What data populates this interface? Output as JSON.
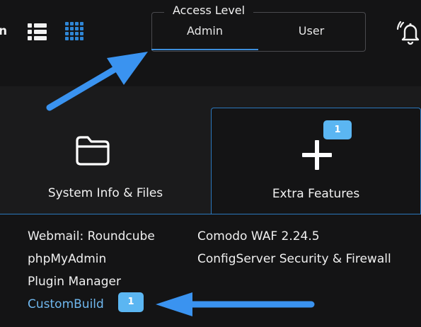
{
  "topbar": {
    "partial_label": "n",
    "list_view_icon": "list-view-icon",
    "grid_view_icon": "grid-view-icon",
    "notifications_icon": "bell-icon"
  },
  "access_level": {
    "legend": "Access Level",
    "tabs": [
      "Admin",
      "User"
    ],
    "selected": "Admin"
  },
  "cards": {
    "system_info": {
      "label": "System Info & Files",
      "icon": "folder-icon"
    },
    "extra_features": {
      "label": "Extra Features",
      "icon": "plus-icon",
      "badge": "1"
    }
  },
  "extra_features_panel": {
    "left_links": [
      "Webmail: Roundcube",
      "phpMyAdmin",
      "Plugin Manager",
      "CustomBuild"
    ],
    "right_links": [
      "Comodo WAF 2.24.5",
      "ConfigServer Security & Firewall"
    ],
    "custombuild_badge": "1"
  },
  "colors": {
    "accent_blue": "#2b78bd",
    "badge_blue": "#5bb6f2",
    "link_active": "#6fb7ee",
    "arrow_blue": "#3a93f0",
    "background": "#1b1b1c"
  }
}
